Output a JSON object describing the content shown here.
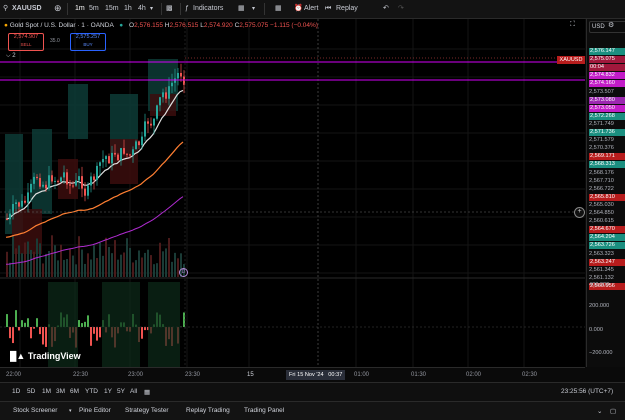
{
  "toolbar": {
    "symbol": "XAUUSD",
    "timeframes": [
      "1m",
      "5m",
      "15m",
      "1h",
      "4h"
    ],
    "active_timeframe": "1m",
    "indicators_label": "Indicators",
    "alert_label": "Alert",
    "replay_label": "Replay"
  },
  "legend": {
    "title": "Gold Spot / U.S. Dollar · 1 · OANDA",
    "open_label": "O",
    "open": "2,576.155",
    "high_label": "H",
    "high": "2,576.515",
    "low_label": "L",
    "low": "2,574.920",
    "close_label": "C",
    "close": "2,575.075",
    "change": "−1.115 (−0.04%)",
    "sell_price": "2,574.907",
    "sell_label": "SELL",
    "spread": "35.0",
    "buy_price": "2,575.257",
    "buy_label": "BUY",
    "indicator_count": "2"
  },
  "currency": "USD",
  "price_axis": {
    "labels": [
      {
        "text": "2,576.147",
        "color": "#1b8f80"
      },
      {
        "text": "2,575.075",
        "color": "#a0183c"
      },
      {
        "text": "00:04",
        "color": "#a0183c"
      },
      {
        "text": "2,574.832",
        "color": "#c21cc7"
      },
      {
        "text": "2,574.160",
        "color": "#c21cc7"
      },
      {
        "text": "2,573.507",
        "color": ""
      },
      {
        "text": "2,573.080",
        "color": "#9c27b0"
      },
      {
        "text": "2,573.050",
        "color": "#c21cc7"
      },
      {
        "text": "2,572.268",
        "color": "#1b8f80"
      },
      {
        "text": "2,571.749",
        "color": ""
      },
      {
        "text": "2,571.736",
        "color": "#1b8f80"
      },
      {
        "text": "2,571.579",
        "color": ""
      },
      {
        "text": "2,570.376",
        "color": ""
      },
      {
        "text": "2,569.171",
        "color": "#b71c1c"
      },
      {
        "text": "2,568.313",
        "color": "#1b8f80"
      },
      {
        "text": "2,568.176",
        "color": ""
      },
      {
        "text": "2,567.710",
        "color": ""
      },
      {
        "text": "2,566.722",
        "color": ""
      },
      {
        "text": "2,565.810",
        "color": "#b71c1c"
      },
      {
        "text": "2,565.030",
        "color": ""
      },
      {
        "text": "2,564.850",
        "color": ""
      },
      {
        "text": "2,560.615",
        "color": ""
      },
      {
        "text": "2,564.670",
        "color": "#b71c1c"
      },
      {
        "text": "2,564.204",
        "color": "#1b8f80"
      },
      {
        "text": "2,563.726",
        "color": "#1b8f80"
      },
      {
        "text": "2,563.323",
        "color": ""
      },
      {
        "text": "2,563.247",
        "color": "#b71c1c"
      },
      {
        "text": "2,561.345",
        "color": ""
      },
      {
        "text": "2,561.132",
        "color": ""
      },
      {
        "text": "2,560.956",
        "color": "#b71c1c"
      }
    ],
    "osc_labels": [
      "400.000",
      "200.000",
      "0.000",
      "−200.000"
    ],
    "symbol_tag": "XAUUSD"
  },
  "time_axis": {
    "labels": [
      "22:00",
      "22:30",
      "23:00",
      "23:30",
      "15",
      "01:00",
      "01:30",
      "02:00",
      "02:30"
    ],
    "cursor_label": "Fri 15 Nov '24   00:37"
  },
  "range_bar": {
    "ranges": [
      "1D",
      "5D",
      "1M",
      "3M",
      "6M",
      "YTD",
      "1Y",
      "5Y",
      "All"
    ],
    "clock": "23:25:56 (UTC+7)"
  },
  "panel_bar": {
    "tabs": [
      "Stock Screener",
      "Pine Editor",
      "Strategy Tester",
      "Replay Trading",
      "Trading Panel"
    ]
  },
  "logo_text": "TradingView",
  "colors": {
    "bull": "#26a69a",
    "bear": "#ef5350",
    "magenta": "#d500f9",
    "background": "#000000"
  }
}
